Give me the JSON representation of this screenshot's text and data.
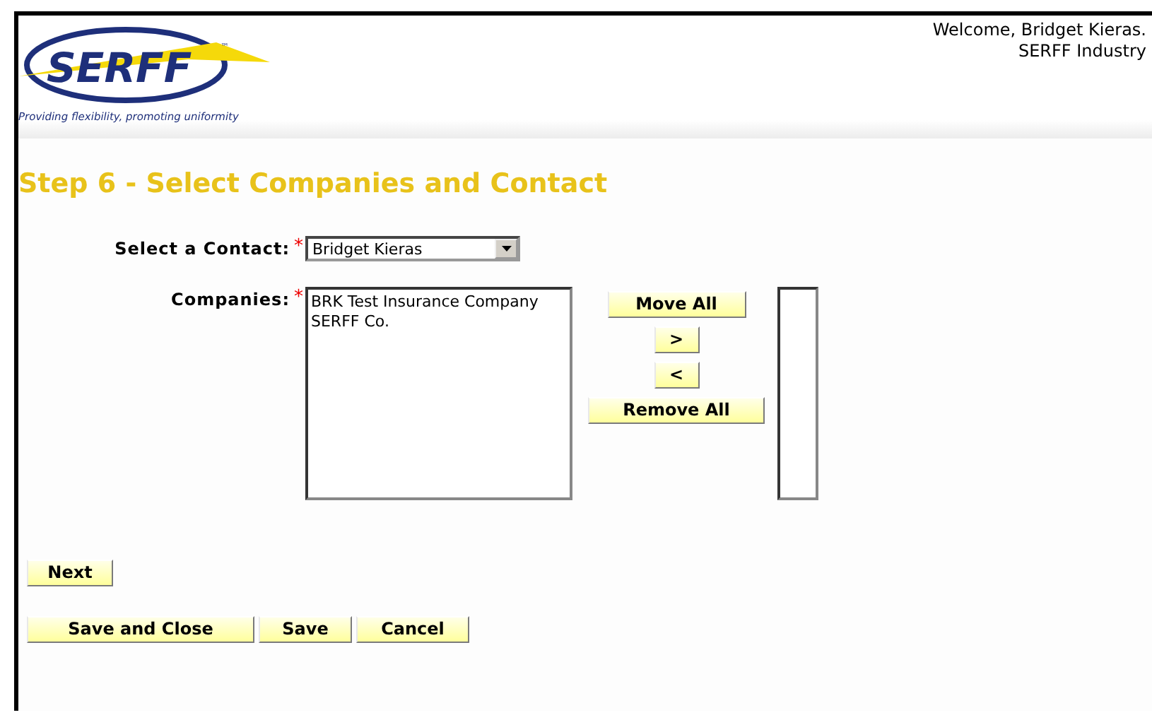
{
  "header": {
    "logo_text": "SERFF",
    "trademark": "™",
    "tagline": "Providing flexibility, promoting uniformity",
    "welcome": "Welcome, Bridget Kieras.",
    "organization": "SERFF Industry"
  },
  "title": "Step 6 - Select Companies and Contact",
  "contact": {
    "label": "Select a Contact:",
    "required_mark": "*",
    "value": "Bridget Kieras"
  },
  "companies": {
    "label": "Companies:",
    "required_mark": "*",
    "available": [
      "BRK Test Insurance Company",
      "SERFF Co."
    ]
  },
  "transfer_buttons": [
    "Move All",
    ">",
    "<",
    "Remove All"
  ],
  "next_button": "Next",
  "footer_buttons": [
    "Save and Close",
    "Save",
    "Cancel"
  ]
}
